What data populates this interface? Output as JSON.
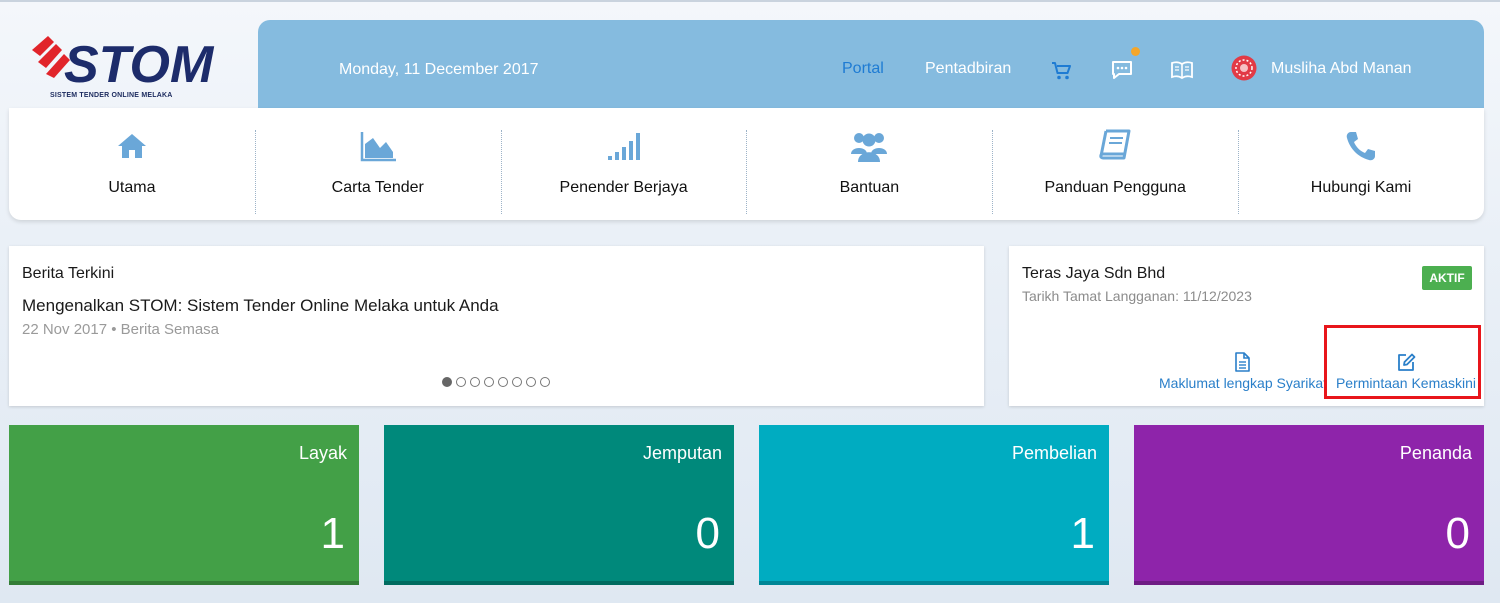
{
  "logo": {
    "text": "STOM",
    "tagline": "SISTEM TENDER ONLINE MELAKA"
  },
  "header": {
    "date": "Monday, 11 December 2017",
    "nav": [
      {
        "label": "Portal",
        "active": true
      },
      {
        "label": "Pentadbiran",
        "active": false
      }
    ],
    "icons": [
      "cart-icon",
      "chat-icon",
      "book-icon"
    ],
    "user_name": "Musliha Abd Manan"
  },
  "menu": [
    {
      "label": "Utama",
      "icon": "home-icon"
    },
    {
      "label": "Carta Tender",
      "icon": "area-chart-icon"
    },
    {
      "label": "Penender Berjaya",
      "icon": "signal-bars-icon"
    },
    {
      "label": "Bantuan",
      "icon": "users-icon"
    },
    {
      "label": "Panduan Pengguna",
      "icon": "book-icon"
    },
    {
      "label": "Hubungi Kami",
      "icon": "phone-icon"
    }
  ],
  "news": {
    "title": "Berita Terkini",
    "headline": "Mengenalkan STOM: Sistem Tender Online Melaka untuk Anda",
    "meta": "22 Nov 2017 • Berita Semasa",
    "slide_count": 8,
    "active_slide": 0
  },
  "company": {
    "name": "Teras Jaya Sdn Bhd",
    "subscription": "Tarikh Tamat Langganan: 11/12/2023",
    "status": "AKTIF",
    "status_color": "#4caf50",
    "actions": [
      {
        "label": "Maklumat lengkap Syarikat",
        "icon": "document-icon"
      },
      {
        "label": "Permintaan Kemaskini",
        "icon": "edit-icon"
      }
    ]
  },
  "tiles": [
    {
      "label": "Layak",
      "count": "1",
      "color": "#43a047"
    },
    {
      "label": "Jemputan",
      "count": "0",
      "color": "#00897b"
    },
    {
      "label": "Pembelian",
      "count": "1",
      "color": "#00acc1"
    },
    {
      "label": "Penanda",
      "count": "0",
      "color": "#8e24aa"
    }
  ]
}
